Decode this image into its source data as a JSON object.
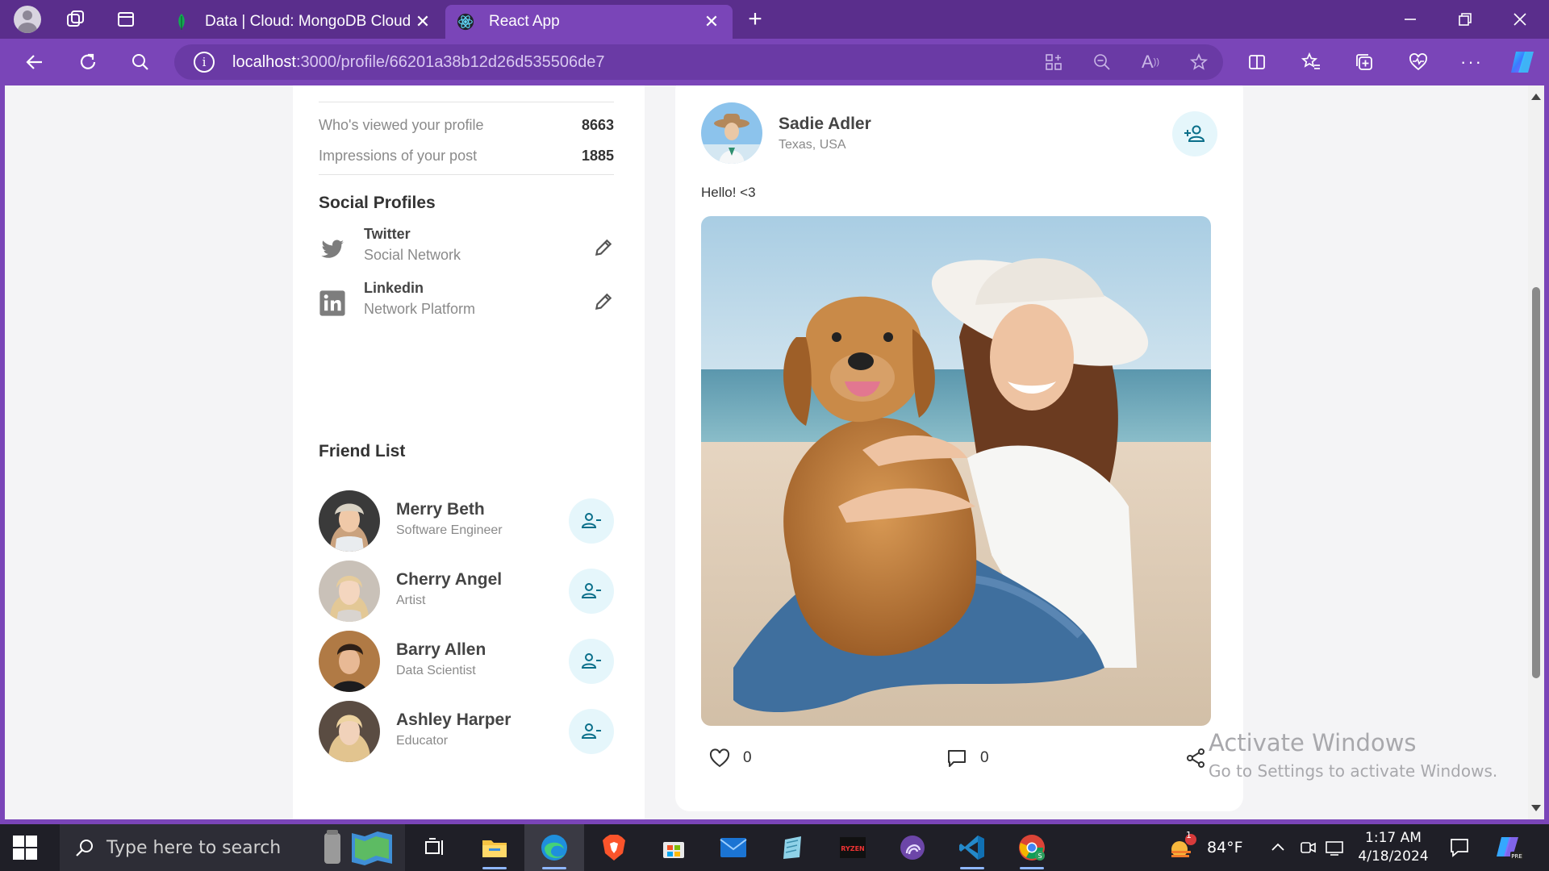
{
  "browser": {
    "tabs": [
      {
        "title": "Data | Cloud: MongoDB Cloud",
        "active": false
      },
      {
        "title": "React App",
        "active": true
      }
    ],
    "url_host": "localhost",
    "url_path": ":3000/profile/66201a38b12d26d535506de7",
    "colors": {
      "tabbar": "#5a2e8c",
      "toolbar": "#7a45b8"
    }
  },
  "stats": [
    {
      "label": "Who's viewed your profile",
      "value": "8663"
    },
    {
      "label": "Impressions of your post",
      "value": "1885"
    }
  ],
  "social": {
    "title": "Social Profiles",
    "items": [
      {
        "name": "Twitter",
        "sub": "Social Network",
        "icon": "twitter-icon"
      },
      {
        "name": "Linkedin",
        "sub": "Network Platform",
        "icon": "linkedin-icon"
      }
    ]
  },
  "friends": {
    "title": "Friend List",
    "items": [
      {
        "name": "Merry Beth",
        "occupation": "Software Engineer"
      },
      {
        "name": "Cherry Angel",
        "occupation": "Artist"
      },
      {
        "name": "Barry Allen",
        "occupation": "Data Scientist"
      },
      {
        "name": "Ashley Harper",
        "occupation": "Educator"
      }
    ]
  },
  "post": {
    "author": "Sadie Adler",
    "location": "Texas, USA",
    "text": "Hello! <3",
    "likes": "0",
    "comments": "0"
  },
  "watermark": {
    "line1": "Activate Windows",
    "line2": "Go to Settings to activate Windows."
  },
  "taskbar": {
    "search_placeholder": "Type here to search",
    "weather": "84°F",
    "weather_badge": "1",
    "time": "1:17 AM",
    "date": "4/18/2024"
  },
  "accent": "#00a8c6"
}
